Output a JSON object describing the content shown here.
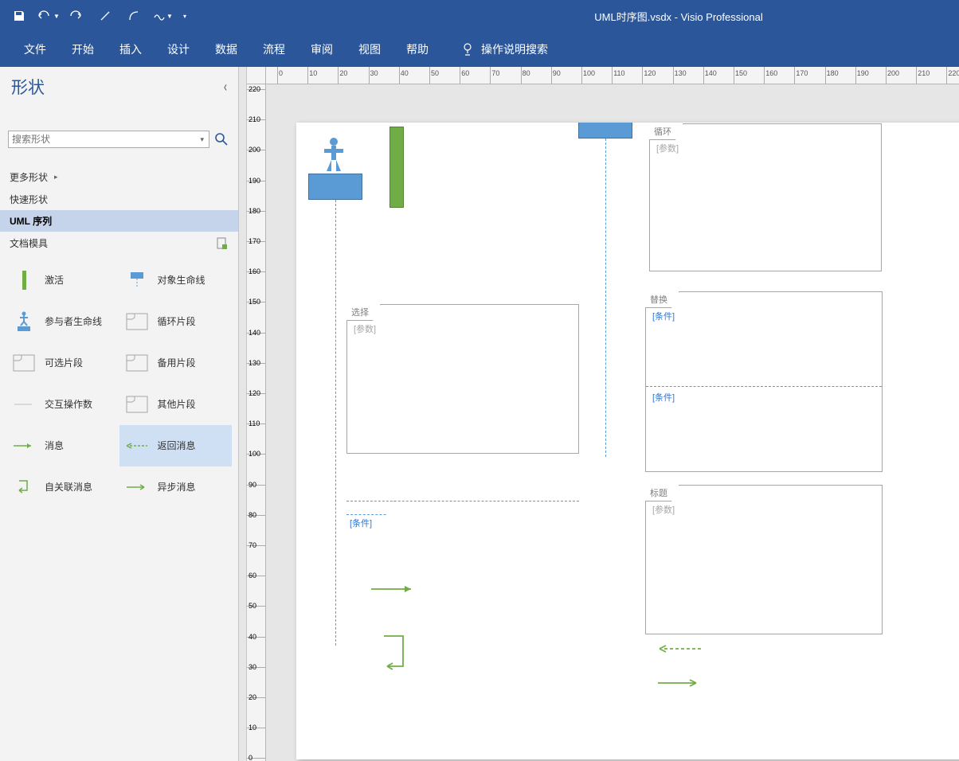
{
  "app": {
    "document_name": "UML时序图.vsdx",
    "app_suffix": " - Visio Professional"
  },
  "ribbon": {
    "tabs": [
      "文件",
      "开始",
      "插入",
      "设计",
      "数据",
      "流程",
      "审阅",
      "视图",
      "帮助"
    ],
    "tell_me": "操作说明搜索"
  },
  "shapes_panel": {
    "title": "形状",
    "search_placeholder": "搜索形状",
    "more_shapes": "更多形状",
    "quick_shapes": "快速形状",
    "active_stencil": "UML 序列",
    "doc_stencil": "文档模具",
    "shape_list": [
      {
        "name": "activation",
        "label": "激活"
      },
      {
        "name": "object-lifeline",
        "label": "对象生命线"
      },
      {
        "name": "actor-lifeline",
        "label": "参与者生命线"
      },
      {
        "name": "loop-fragment",
        "label": "循环片段"
      },
      {
        "name": "opt-fragment",
        "label": "可选片段"
      },
      {
        "name": "alt-fragment",
        "label": "备用片段"
      },
      {
        "name": "interaction-count",
        "label": "交互操作数"
      },
      {
        "name": "other-fragment",
        "label": "其他片段"
      },
      {
        "name": "message",
        "label": "消息"
      },
      {
        "name": "return-message",
        "label": "返回消息"
      },
      {
        "name": "self-message",
        "label": "自关联消息"
      },
      {
        "name": "async-message",
        "label": "异步消息"
      }
    ],
    "selected_shape": "return-message"
  },
  "ruler_h_labels": [
    0,
    10,
    20,
    30,
    40,
    50,
    60,
    70,
    80,
    90,
    100,
    110,
    120,
    130,
    140,
    150,
    160,
    170,
    180,
    190,
    200,
    210,
    220
  ],
  "ruler_v_labels": [
    220,
    210,
    200,
    190,
    180,
    170,
    160,
    150,
    140,
    130,
    120,
    110,
    100,
    90,
    80,
    70,
    60,
    50,
    40,
    30,
    20,
    10,
    0
  ],
  "canvas": {
    "frag_loop": {
      "label": "循环",
      "param": "[参数]"
    },
    "frag_select": {
      "label": "选择",
      "param": "[参数]"
    },
    "frag_alt": {
      "label": "替换",
      "cond1": "[条件]",
      "cond2": "[条件]"
    },
    "frag_title": {
      "label": "标题",
      "param": "[参数]"
    },
    "opt_cond": "[条件]"
  }
}
